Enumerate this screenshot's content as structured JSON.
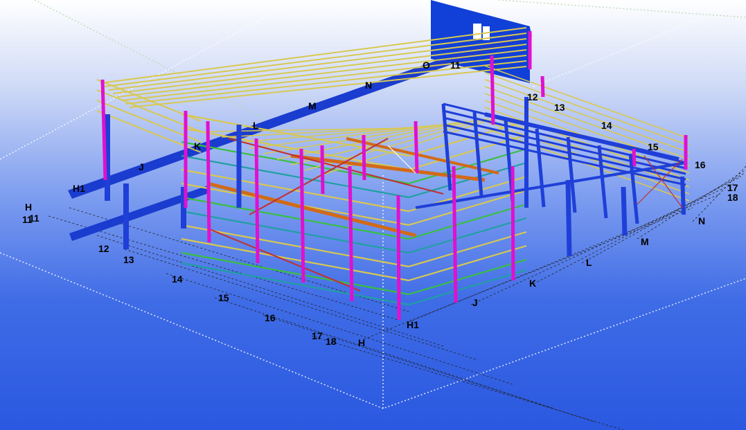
{
  "viewport": {
    "name": "3D model view"
  },
  "grid_labels": {
    "front_numbers": [
      "11",
      "12",
      "13",
      "14",
      "15",
      "16",
      "17",
      "18"
    ],
    "front_letters": [
      "H",
      "H1",
      "J",
      "K",
      "L",
      "M",
      "N"
    ],
    "top_letters": [
      "H1",
      "J",
      "K",
      "L",
      "M",
      "N",
      "O"
    ],
    "top_numbers": [
      "11",
      "12",
      "13",
      "14",
      "15",
      "16",
      "17",
      "18"
    ],
    "left_letter": "H",
    "left_number": "11"
  },
  "colors": {
    "beam_blue": "#1f3fd8",
    "column_magenta": "#e010d0",
    "purlin_yellow": "#d8c850",
    "bracing_orange": "#d26a18",
    "member_green": "#38c040",
    "member_teal": "#20a0a0",
    "member_red": "#c03030",
    "grid_line": "#222222"
  }
}
